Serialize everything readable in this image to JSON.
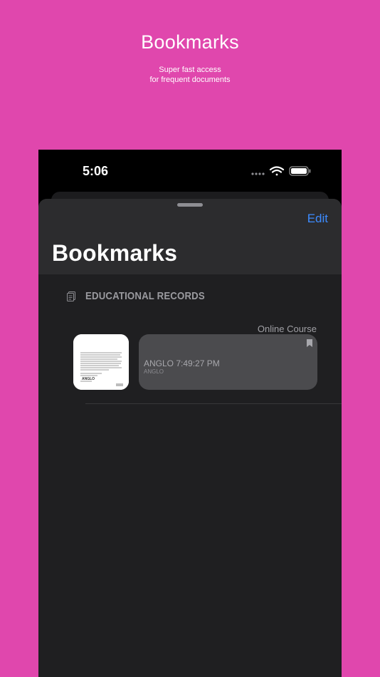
{
  "promo": {
    "title": "Bookmarks",
    "subtitle_line1": "Super fast access",
    "subtitle_line2": "for frequent documents"
  },
  "status_bar": {
    "time": "5:06",
    "icons": [
      "signal-dots-icon",
      "wifi-icon",
      "battery-icon"
    ]
  },
  "nav": {
    "edit_label": "Edit",
    "title": "Bookmarks"
  },
  "section": {
    "icon": "document-icon",
    "title": "EDUCATIONAL RECORDS"
  },
  "items": [
    {
      "category": "Online Course",
      "title": "ANGLO 7:49:27 PM",
      "subtitle": "ANGLO",
      "thumb_caption": "ANGLO",
      "bookmarked": true
    }
  ],
  "colors": {
    "background": "#e047ad",
    "accent": "#3d8bff",
    "sheet": "#1f1f21",
    "header": "#2c2c2e",
    "card": "#4b4b4e"
  }
}
